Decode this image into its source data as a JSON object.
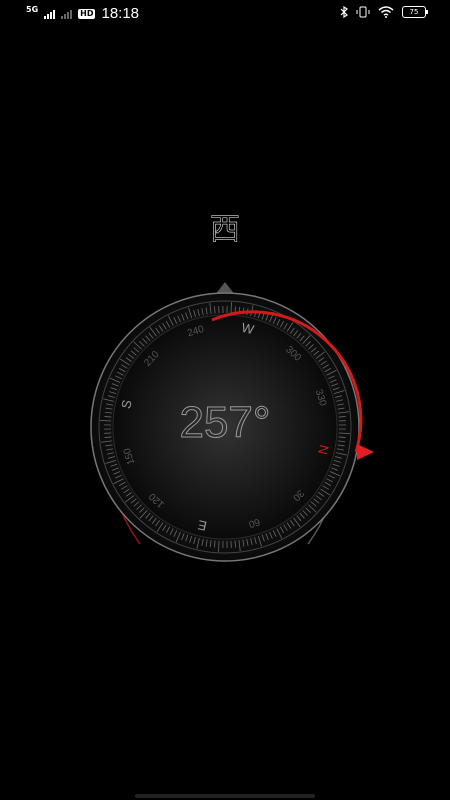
{
  "status_bar": {
    "network": "5G",
    "hd_label": "HD",
    "time": "18:18",
    "battery": "75"
  },
  "compass": {
    "direction_label": "西",
    "heading": "257°",
    "accent_color": "#d21a1a"
  },
  "dial_labels": [
    "N",
    "30",
    "60",
    "E",
    "120",
    "150",
    "S",
    "210",
    "240",
    "W",
    "300",
    "330"
  ],
  "icons": [
    "bluetooth-icon",
    "vibrate-icon",
    "wifi-icon",
    "battery-icon",
    "heading-pointer-icon"
  ]
}
